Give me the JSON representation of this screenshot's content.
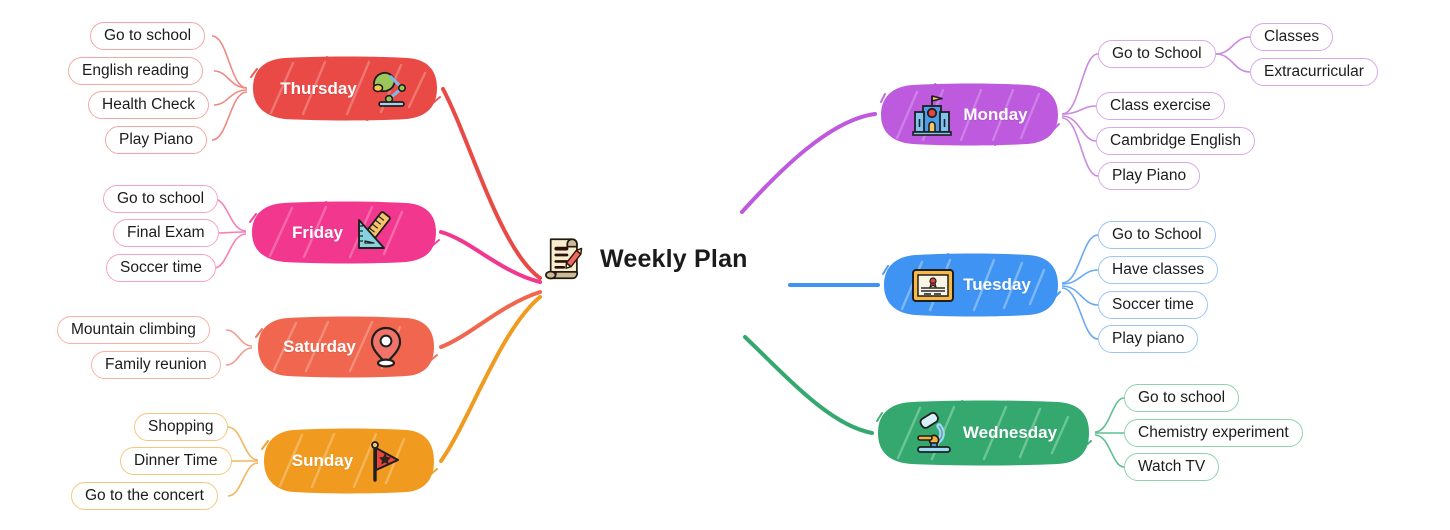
{
  "central": {
    "label": "Weekly Plan",
    "icon": "scroll-pencil-icon"
  },
  "colors": {
    "monday": "#bd5ade",
    "tuesday": "#3f93f2",
    "wednesday": "#34a86f",
    "thursday": "#ea4a45",
    "friday": "#f2378f",
    "saturday": "#f0664f",
    "sunday": "#f09a20",
    "text_dark": "#1c1c1c",
    "node_text": "#ffffff"
  },
  "branches": [
    {
      "id": "monday",
      "label": "Monday",
      "icon": "school-building-icon",
      "side": "right",
      "color": "#bd5ade",
      "pill_border": "#d9a8ea",
      "children": [
        {
          "label": "Go to School",
          "children": [
            {
              "label": "Classes"
            },
            {
              "label": "Extracurricular"
            }
          ]
        },
        {
          "label": "Class exercise",
          "children": []
        },
        {
          "label": "Cambridge English",
          "children": []
        },
        {
          "label": "Play Piano",
          "children": []
        }
      ]
    },
    {
      "id": "tuesday",
      "label": "Tuesday",
      "icon": "certificate-icon",
      "side": "right",
      "color": "#3f93f2",
      "pill_border": "#9bc6f7",
      "children": [
        {
          "label": "Go to School",
          "children": []
        },
        {
          "label": "Have classes",
          "children": []
        },
        {
          "label": "Soccer time",
          "children": []
        },
        {
          "label": "Play piano",
          "children": []
        }
      ]
    },
    {
      "id": "wednesday",
      "label": "Wednesday",
      "icon": "microscope-icon",
      "side": "right",
      "color": "#34a86f",
      "pill_border": "#8ed3ae",
      "children": [
        {
          "label": "Go to school",
          "children": []
        },
        {
          "label": "Chemistry experiment",
          "children": []
        },
        {
          "label": "Watch TV",
          "children": []
        }
      ]
    },
    {
      "id": "thursday",
      "label": "Thursday",
      "icon": "desk-lamp-icon",
      "side": "left",
      "color": "#ea4a45",
      "pill_border": "#f4a9a4",
      "children": [
        {
          "label": "Go to school",
          "children": []
        },
        {
          "label": "English reading",
          "children": []
        },
        {
          "label": "Health Check",
          "children": []
        },
        {
          "label": "Play Piano",
          "children": []
        }
      ]
    },
    {
      "id": "friday",
      "label": "Friday",
      "icon": "rulers-icon",
      "side": "left",
      "color": "#f2378f",
      "pill_border": "#f7a3c8",
      "children": [
        {
          "label": "Go to school",
          "children": []
        },
        {
          "label": "Final Exam",
          "children": []
        },
        {
          "label": "Soccer time",
          "children": []
        }
      ]
    },
    {
      "id": "saturday",
      "label": "Saturday",
      "icon": "location-pin-icon",
      "side": "left",
      "color": "#f0664f",
      "pill_border": "#f7b3a5",
      "children": [
        {
          "label": "Mountain climbing",
          "children": []
        },
        {
          "label": "Family reunion",
          "children": []
        }
      ]
    },
    {
      "id": "sunday",
      "label": "Sunday",
      "icon": "red-flag-icon",
      "side": "left",
      "color": "#f09a20",
      "pill_border": "#f6c77e",
      "children": [
        {
          "label": "Shopping",
          "children": []
        },
        {
          "label": "Dinner Time",
          "children": []
        },
        {
          "label": "Go to the concert",
          "children": []
        }
      ]
    }
  ]
}
